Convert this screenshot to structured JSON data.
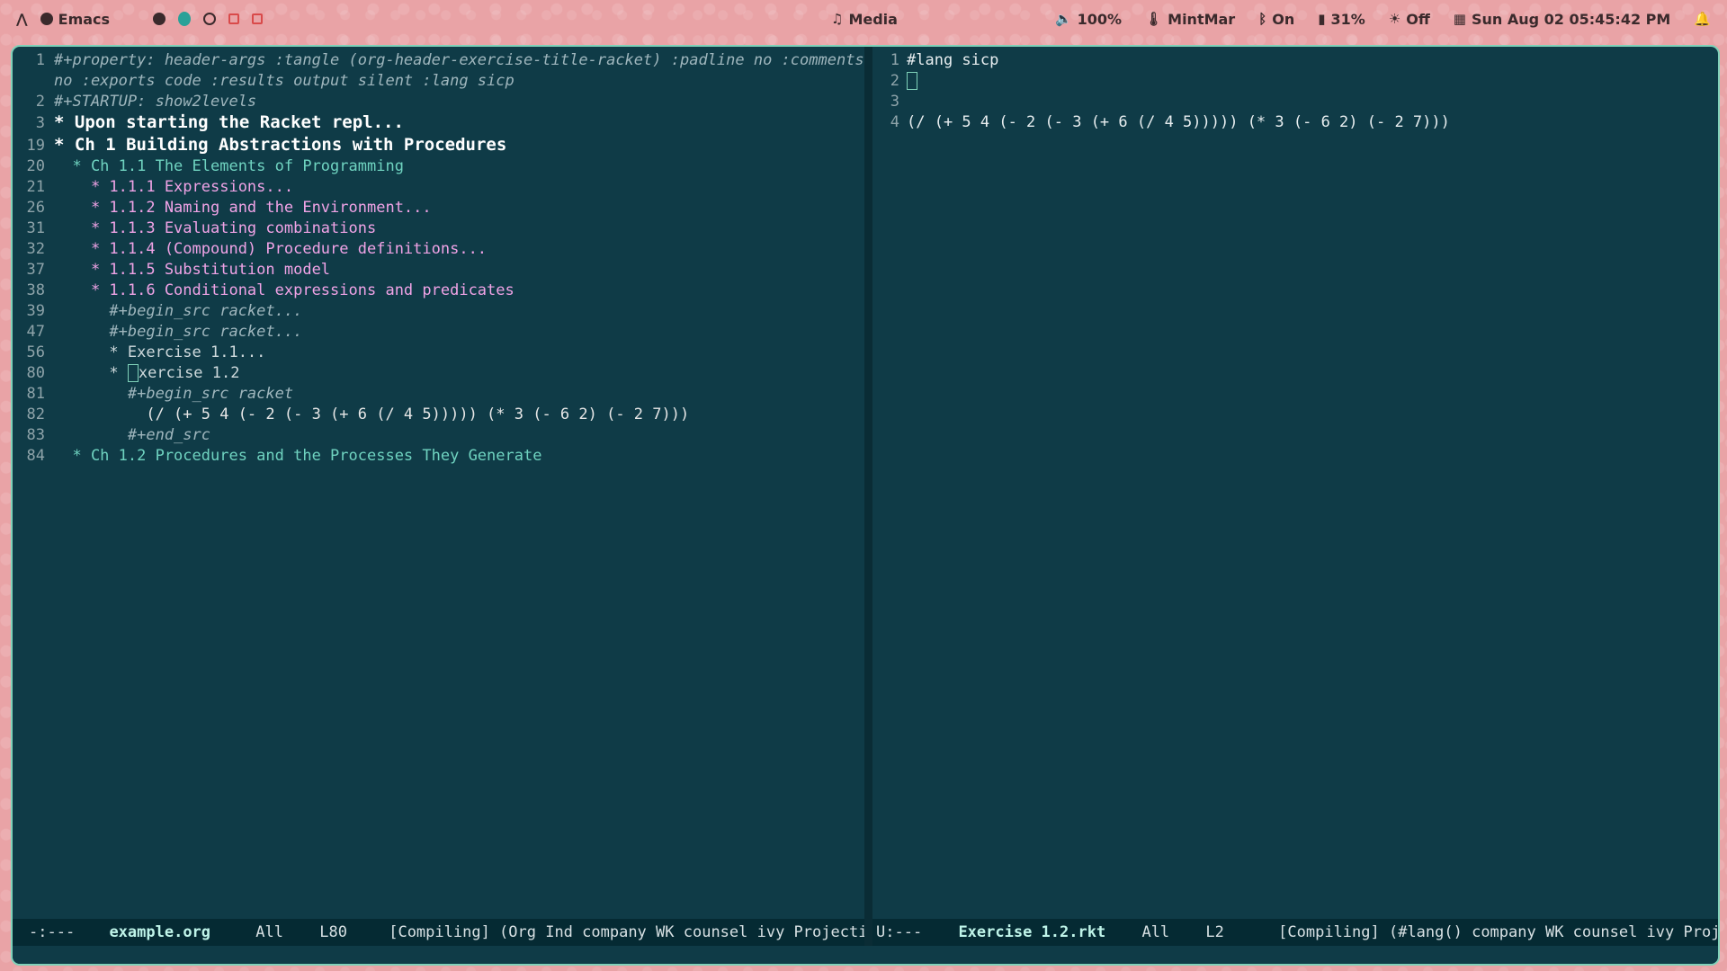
{
  "topbar": {
    "app_label": "Emacs",
    "media_label": "Media",
    "volume": "100%",
    "weather": "MintMar",
    "bluetooth": "On",
    "battery": "31%",
    "brightness": "Off",
    "datetime": "Sun Aug 02 05:45:42 PM"
  },
  "left_pane": {
    "lines": [
      {
        "n": "1",
        "text": "#+property: header-args :tangle (org-header-exercise-title-racket) :padline no :comments"
      },
      {
        "n": "",
        "text": "no :exports code :results output silent :lang sicp"
      },
      {
        "n": "2",
        "text": "#+STARTUP: show2levels"
      },
      {
        "n": "3",
        "text": "* Upon starting the Racket repl..."
      },
      {
        "n": "19",
        "text": "* Ch 1 Building Abstractions with Procedures"
      },
      {
        "n": "20",
        "text": "  * Ch 1.1 The Elements of Programming"
      },
      {
        "n": "21",
        "text": "    * 1.1.1 Expressions..."
      },
      {
        "n": "26",
        "text": "    * 1.1.2 Naming and the Environment..."
      },
      {
        "n": "31",
        "text": "    * 1.1.3 Evaluating combinations"
      },
      {
        "n": "32",
        "text": "    * 1.1.4 (Compound) Procedure definitions..."
      },
      {
        "n": "37",
        "text": "    * 1.1.5 Substitution model"
      },
      {
        "n": "38",
        "text": "    * 1.1.6 Conditional expressions and predicates"
      },
      {
        "n": "39",
        "text": "      #+begin_src racket..."
      },
      {
        "n": "47",
        "text": "      #+begin_src racket..."
      },
      {
        "n": "56",
        "text": "      * Exercise 1.1..."
      },
      {
        "n": "80",
        "text": "xercise 1.2"
      },
      {
        "n": "81",
        "text": "        #+begin_src racket"
      },
      {
        "n": "82",
        "text": "          (/ (+ 5 4 (- 2 (- 3 (+ 6 (/ 4 5))))) (* 3 (- 6 2) (- 2 7)))"
      },
      {
        "n": "83",
        "text": "        #+end_src"
      },
      {
        "n": "84",
        "text": "  * Ch 1.2 Procedures and the Processes They Generate"
      }
    ],
    "line80_prefix": "      * ",
    "modeline": {
      "state": "-:---",
      "file": "example.org",
      "pos": "All",
      "line": "L80",
      "modes": "[Compiling] (Org Ind company WK counsel ivy Projectile[sic"
    }
  },
  "right_pane": {
    "lines": [
      {
        "n": "1",
        "text": "#lang sicp"
      },
      {
        "n": "2",
        "text": ""
      },
      {
        "n": "3",
        "text": ""
      },
      {
        "n": "4",
        "text": "(/ (+ 5 4 (- 2 (- 3 (+ 6 (/ 4 5))))) (* 3 (- 6 2) (- 2 7)))"
      }
    ],
    "modeline": {
      "state": "U:---",
      "file": "Exercise 1.2.rkt",
      "pos": "All",
      "line": "L2",
      "modes": "[Compiling] (#lang() company WK counsel ivy Projectile"
    }
  },
  "icons": {
    "launcher": "arch-icon",
    "emacs": "emacs-icon",
    "media": "music-note-icon",
    "volume": "speaker-icon",
    "weather": "thermometer-icon",
    "bluetooth": "bluetooth-icon",
    "battery": "battery-icon",
    "brightness": "bulb-icon",
    "calendar": "calendar-icon",
    "bell": "bell-icon"
  }
}
